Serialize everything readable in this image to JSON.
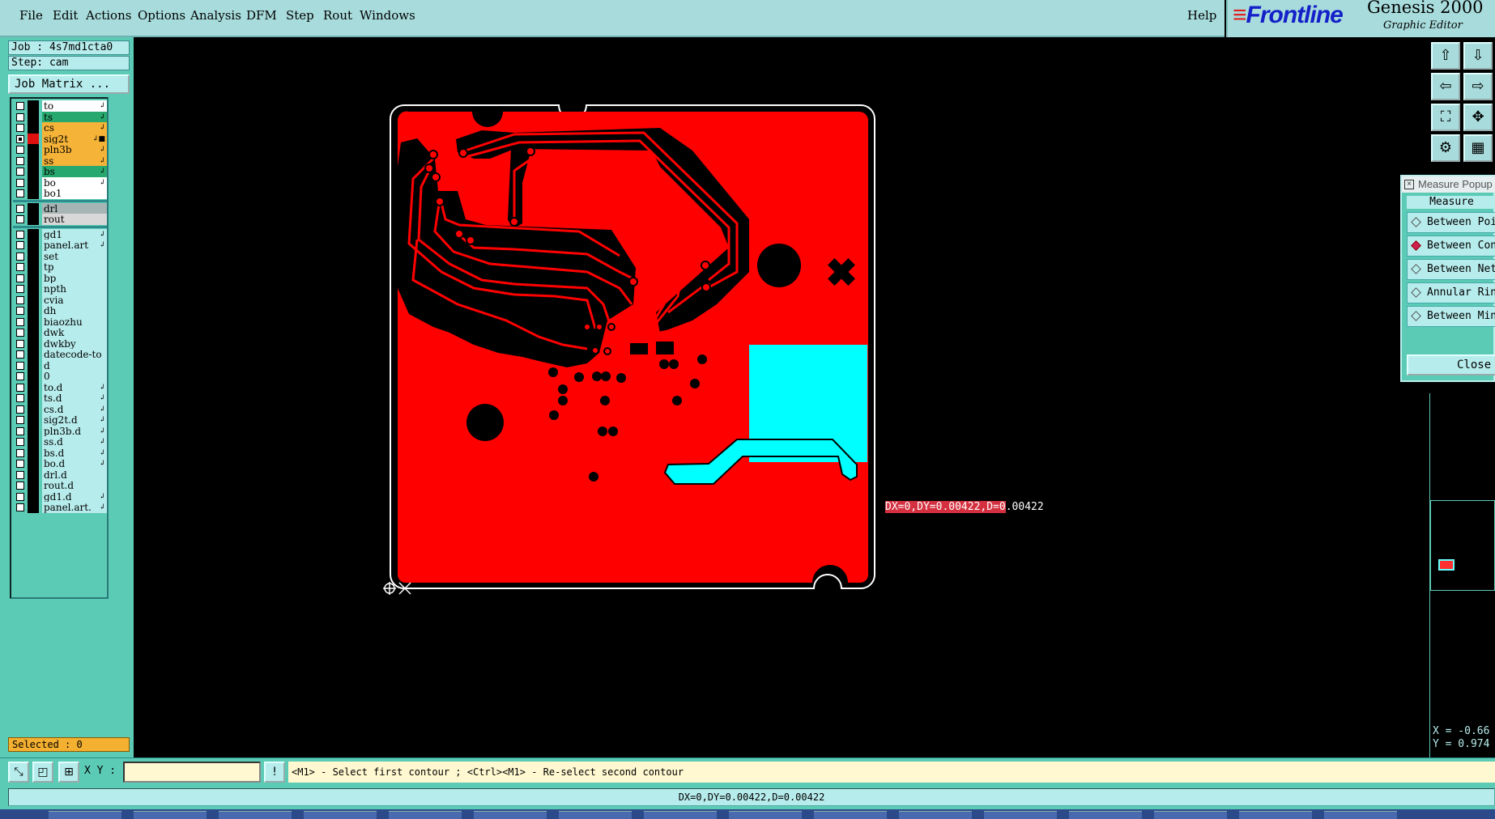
{
  "menubar": {
    "items": [
      "File",
      "Edit",
      "Actions",
      "Options",
      "Analysis",
      "DFM",
      "Step",
      "Rout",
      "Windows"
    ],
    "help": "Help"
  },
  "logo": {
    "brand": "Frontline",
    "product": "Genesis 2000",
    "subtitle": "Graphic Editor"
  },
  "job": {
    "job_label": "Job : 4s7md1cta0",
    "step_label": "Step: cam",
    "matrix_button": "Job Matrix ..."
  },
  "layers": [
    {
      "name": "to",
      "color": "#ffffff",
      "checked": false,
      "mark": "↲"
    },
    {
      "name": "ts",
      "color": "#27a86e",
      "checked": false,
      "mark": "↲"
    },
    {
      "name": "cs",
      "color": "#f5b338",
      "checked": false,
      "mark": "↲"
    },
    {
      "name": "sig2t",
      "color": "#f5b338",
      "checked": true,
      "mark": "↲■",
      "swatch": "#e01010"
    },
    {
      "name": "pln3b",
      "color": "#f5b338",
      "checked": false,
      "mark": "↲"
    },
    {
      "name": "ss",
      "color": "#f5b338",
      "checked": false,
      "mark": "↲"
    },
    {
      "name": "bs",
      "color": "#27a86e",
      "checked": false,
      "mark": "↲"
    },
    {
      "name": "bo",
      "color": "#ffffff",
      "checked": false,
      "mark": "↲"
    },
    {
      "name": "bo1",
      "color": "#ffffff",
      "checked": false,
      "mark": ""
    },
    {
      "name": "drl",
      "color": "#a6b4b4",
      "checked": false,
      "mark": ""
    },
    {
      "name": "rout",
      "color": "#d8d8d8",
      "checked": false,
      "mark": ""
    },
    {
      "name": "gd1",
      "color": "#b7ecec",
      "checked": false,
      "mark": "↲"
    },
    {
      "name": "panel.art",
      "color": "#b7ecec",
      "checked": false,
      "mark": "↲"
    },
    {
      "name": "set",
      "color": "#b7ecec",
      "checked": false,
      "mark": ""
    },
    {
      "name": "tp",
      "color": "#b7ecec",
      "checked": false,
      "mark": ""
    },
    {
      "name": "bp",
      "color": "#b7ecec",
      "checked": false,
      "mark": ""
    },
    {
      "name": "npth",
      "color": "#b7ecec",
      "checked": false,
      "mark": ""
    },
    {
      "name": "cvia",
      "color": "#b7ecec",
      "checked": false,
      "mark": ""
    },
    {
      "name": "dh",
      "color": "#b7ecec",
      "checked": false,
      "mark": ""
    },
    {
      "name": "biaozhu",
      "color": "#b7ecec",
      "checked": false,
      "mark": ""
    },
    {
      "name": "dwk",
      "color": "#b7ecec",
      "checked": false,
      "mark": ""
    },
    {
      "name": "dwkby",
      "color": "#b7ecec",
      "checked": false,
      "mark": ""
    },
    {
      "name": "datecode-to",
      "color": "#b7ecec",
      "checked": false,
      "mark": ""
    },
    {
      "name": "d",
      "color": "#b7ecec",
      "checked": false,
      "mark": ""
    },
    {
      "name": "0",
      "color": "#b7ecec",
      "checked": false,
      "mark": ""
    },
    {
      "name": "to.d",
      "color": "#b7ecec",
      "checked": false,
      "mark": "↲"
    },
    {
      "name": "ts.d",
      "color": "#b7ecec",
      "checked": false,
      "mark": "↲"
    },
    {
      "name": "cs.d",
      "color": "#b7ecec",
      "checked": false,
      "mark": "↲"
    },
    {
      "name": "sig2t.d",
      "color": "#b7ecec",
      "checked": false,
      "mark": "↲"
    },
    {
      "name": "pln3b.d",
      "color": "#b7ecec",
      "checked": false,
      "mark": "↲"
    },
    {
      "name": "ss.d",
      "color": "#b7ecec",
      "checked": false,
      "mark": "↲"
    },
    {
      "name": "bs.d",
      "color": "#b7ecec",
      "checked": false,
      "mark": "↲"
    },
    {
      "name": "bo.d",
      "color": "#b7ecec",
      "checked": false,
      "mark": "↲"
    },
    {
      "name": "drl.d",
      "color": "#b7ecec",
      "checked": false,
      "mark": ""
    },
    {
      "name": "rout.d",
      "color": "#b7ecec",
      "checked": false,
      "mark": ""
    },
    {
      "name": "gd1.d",
      "color": "#b7ecec",
      "checked": false,
      "mark": "↲"
    },
    {
      "name": "panel.art.",
      "color": "#b7ecec",
      "checked": false,
      "mark": "↲"
    }
  ],
  "selected_label": "Selected : 0",
  "measure_popup": {
    "title": "Measure Popup",
    "header": "Measure",
    "options": [
      {
        "label": "Between Points",
        "active": false
      },
      {
        "label": "Between Contours",
        "active": true
      },
      {
        "label": "Between Nets",
        "active": false
      },
      {
        "label": "Annular Ring",
        "active": false
      },
      {
        "label": "Between Min",
        "active": false
      }
    ],
    "close": "Close"
  },
  "coords": {
    "x": "X = -0.66",
    "y": "Y = 0.974"
  },
  "measurement_label": {
    "highlight": "DX=0,DY=0.00422,D=0",
    "rest": ".00422"
  },
  "command": {
    "xy_label": "X Y :",
    "xy_value": "",
    "hint": "<M1> - Select first contour ; <Ctrl><M1> - Re-select second contour"
  },
  "status": "DX=0,DY=0.00422,D=0.00422",
  "colors": {
    "board": "#ff0000",
    "highlight": "#00ffff",
    "panel": "#5ccbb6",
    "menubar": "#a8dcdc"
  },
  "icons": [
    "zoom-in-icon",
    "zoom-out-icon",
    "pan-left-icon",
    "pan-right-icon",
    "fit-icon",
    "home-icon",
    "settings-icon",
    "grid-icon"
  ]
}
